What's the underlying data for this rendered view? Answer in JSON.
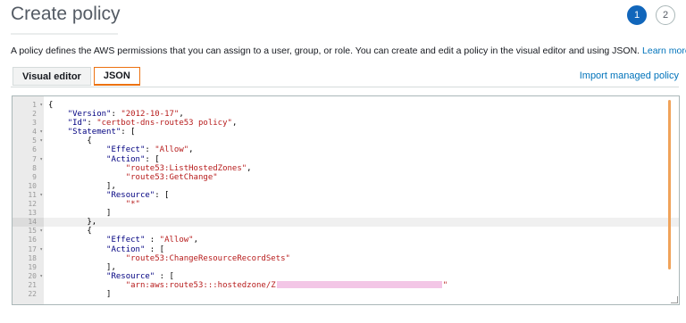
{
  "header": {
    "title": "Create policy",
    "steps": [
      "1",
      "2"
    ]
  },
  "description": {
    "text": "A policy defines the AWS permissions that you can assign to a user, group, or role. You can create and edit a policy in the visual editor and using JSON.",
    "link": "Learn more"
  },
  "tabs": [
    {
      "label": "Visual editor"
    },
    {
      "label": "JSON"
    }
  ],
  "import_link": "Import managed policy",
  "editor": {
    "line_numbers": [
      "1",
      "2",
      "3",
      "4",
      "5",
      "6",
      "7",
      "8",
      "9",
      "10",
      "11",
      "12",
      "13",
      "14",
      "15",
      "16",
      "17",
      "18",
      "19",
      "20",
      "21",
      "22"
    ],
    "lines": [
      "{",
      "    \"Version\": \"2012-10-17\",",
      "    \"Id\": \"certbot-dns-route53 policy\",",
      "    \"Statement\": [",
      "        {",
      "            \"Effect\": \"Allow\",",
      "            \"Action\": [",
      "                \"route53:ListHostedZones\",",
      "                \"route53:GetChange\"",
      "            ],",
      "            \"Resource\": [",
      "                \"*\"",
      "            ]",
      "        },",
      "        {",
      "            \"Effect\" : \"Allow\",",
      "            \"Action\" : [",
      "                \"route53:ChangeResourceRecordSets\"",
      "            ],",
      "            \"Resource\" : [",
      "                \"arn:aws:route53:::hostedzone/Z",
      "            ]"
    ]
  }
}
